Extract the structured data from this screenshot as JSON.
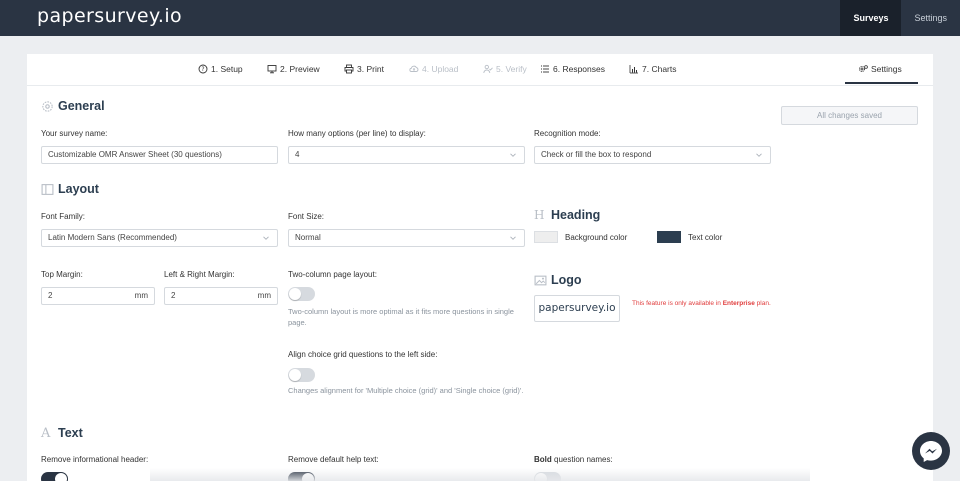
{
  "app": {
    "logo": "papersurvey.io"
  },
  "topnav": [
    {
      "label": "Surveys",
      "active": true
    },
    {
      "label": "Settings",
      "active": false
    }
  ],
  "tabs": [
    {
      "label": "1. Setup",
      "icon": "help-circle-icon",
      "disabled": false
    },
    {
      "label": "2. Preview",
      "icon": "monitor-icon",
      "disabled": false
    },
    {
      "label": "3. Print",
      "icon": "printer-icon",
      "disabled": false
    },
    {
      "label": "4. Upload",
      "icon": "cloud-upload-icon",
      "disabled": true
    },
    {
      "label": "5. Verify",
      "icon": "user-check-icon",
      "disabled": true
    },
    {
      "label": "6. Responses",
      "icon": "list-icon",
      "disabled": false
    },
    {
      "label": "7. Charts",
      "icon": "bar-chart-icon",
      "disabled": false
    },
    {
      "label": "Settings",
      "icon": "gears-icon",
      "disabled": false,
      "active": true
    }
  ],
  "status": {
    "saved_label": "All changes saved"
  },
  "general": {
    "title": "General",
    "survey_name_label": "Your survey name:",
    "survey_name_value": "Customizable OMR Answer Sheet (30 questions)",
    "options_label": "How many options (per line) to display:",
    "options_value": "4",
    "recognition_label": "Recognition mode:",
    "recognition_value": "Check or fill the box to respond"
  },
  "layout": {
    "title": "Layout",
    "font_family_label": "Font Family:",
    "font_family_value": "Latin Modern Sans (Recommended)",
    "font_size_label": "Font Size:",
    "font_size_value": "Normal",
    "top_margin_label": "Top Margin:",
    "top_margin_value": "2",
    "lr_margin_label": "Left & Right Margin:",
    "lr_margin_value": "2",
    "unit": "mm",
    "two_column_label": "Two-column page layout:",
    "two_column_on": false,
    "two_column_help": "Two-column layout is more optimal as it fits more questions in single page.",
    "align_grid_label": "Align choice grid questions to the left side:",
    "align_grid_on": false,
    "align_grid_help": "Changes alignment for 'Multiple choice (grid)' and 'Single choice (grid)'."
  },
  "heading": {
    "title": "Heading",
    "bg_color_label": "Background color",
    "bg_color": "#eeeeee",
    "text_color_label": "Text color",
    "text_color": "#2c3e50"
  },
  "logo_section": {
    "title": "Logo",
    "logo_text": "papersurvey.io",
    "note_prefix": "This feature is only available in ",
    "note_plan": "Enterprise",
    "note_suffix": " plan."
  },
  "text_section": {
    "title": "Text",
    "remove_header_label": "Remove informational header:",
    "remove_header_on": true,
    "remove_help_label": "Remove default help text:",
    "remove_help_on": true,
    "bold_prefix": "Bold",
    "bold_suffix": " question names:",
    "bold_on": false
  },
  "colors": {
    "primary": "#2a3443",
    "accent_red": "#e03c3c",
    "background": "#eceef1"
  }
}
